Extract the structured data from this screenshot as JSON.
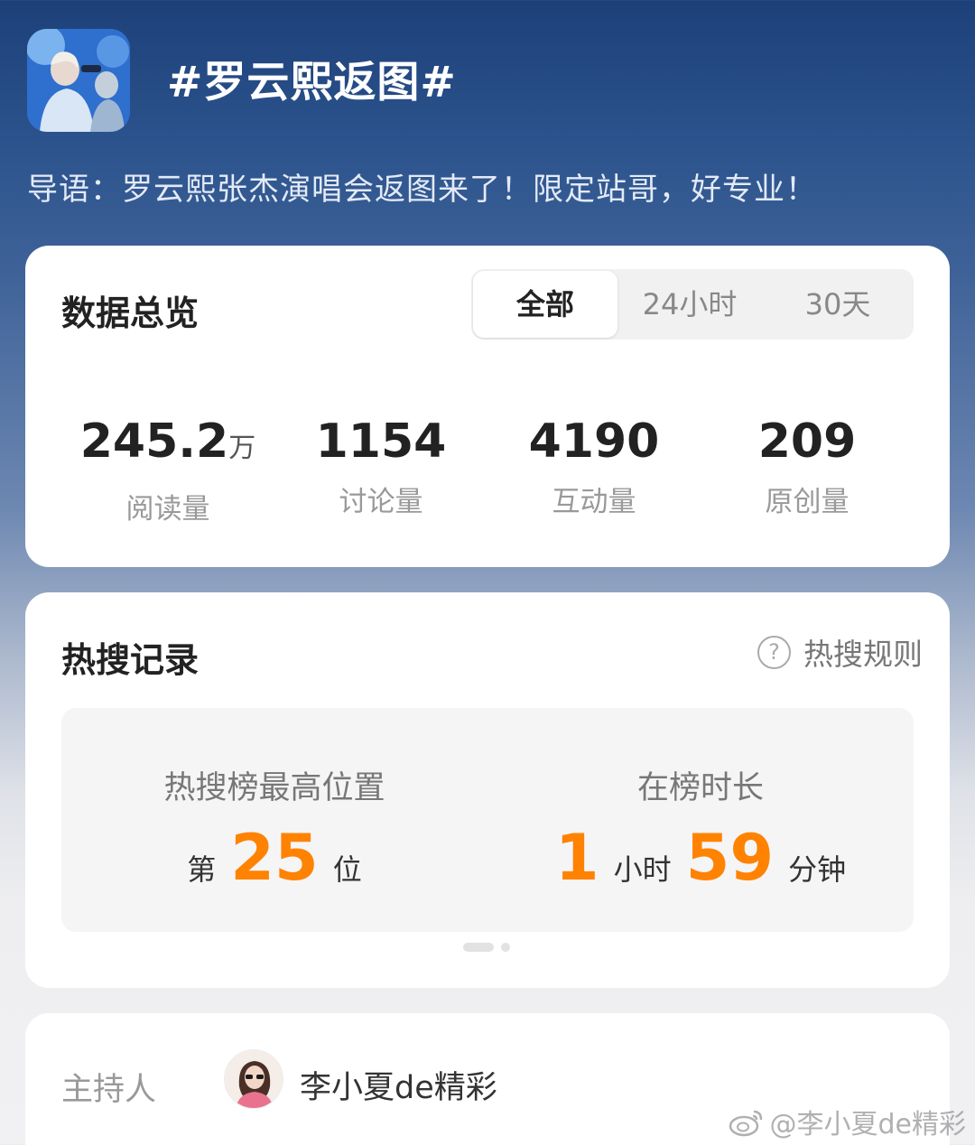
{
  "topic": {
    "title": "#罗云熙返图#",
    "intro": "导语：罗云熙张杰演唱会返图来了！限定站哥，好专业！"
  },
  "overview": {
    "title": "数据总览",
    "tabs": [
      "全部",
      "24小时",
      "30天"
    ],
    "active_tab": "全部",
    "stats": [
      {
        "value": "245.2",
        "unit": "万",
        "label": "阅读量"
      },
      {
        "value": "1154",
        "unit": "",
        "label": "讨论量"
      },
      {
        "value": "4190",
        "unit": "",
        "label": "互动量"
      },
      {
        "value": "209",
        "unit": "",
        "label": "原创量"
      }
    ]
  },
  "hot_search": {
    "title": "热搜记录",
    "rules_label": "热搜规则",
    "rules_icon": "?",
    "highest": {
      "caption": "热搜榜最高位置",
      "prefix": "第",
      "value": "25",
      "suffix": "位"
    },
    "duration": {
      "caption": "在榜时长",
      "hours": "1",
      "hours_unit": "小时",
      "minutes": "59",
      "minutes_unit": "分钟"
    },
    "pager": {
      "count": 2,
      "current": 1
    }
  },
  "host": {
    "label": "主持人",
    "name": "李小夏de精彩"
  },
  "watermark": {
    "text": "@李小夏de精彩"
  },
  "colors": {
    "accent_orange": "#ff8200",
    "header_blue": "#1d4079"
  }
}
